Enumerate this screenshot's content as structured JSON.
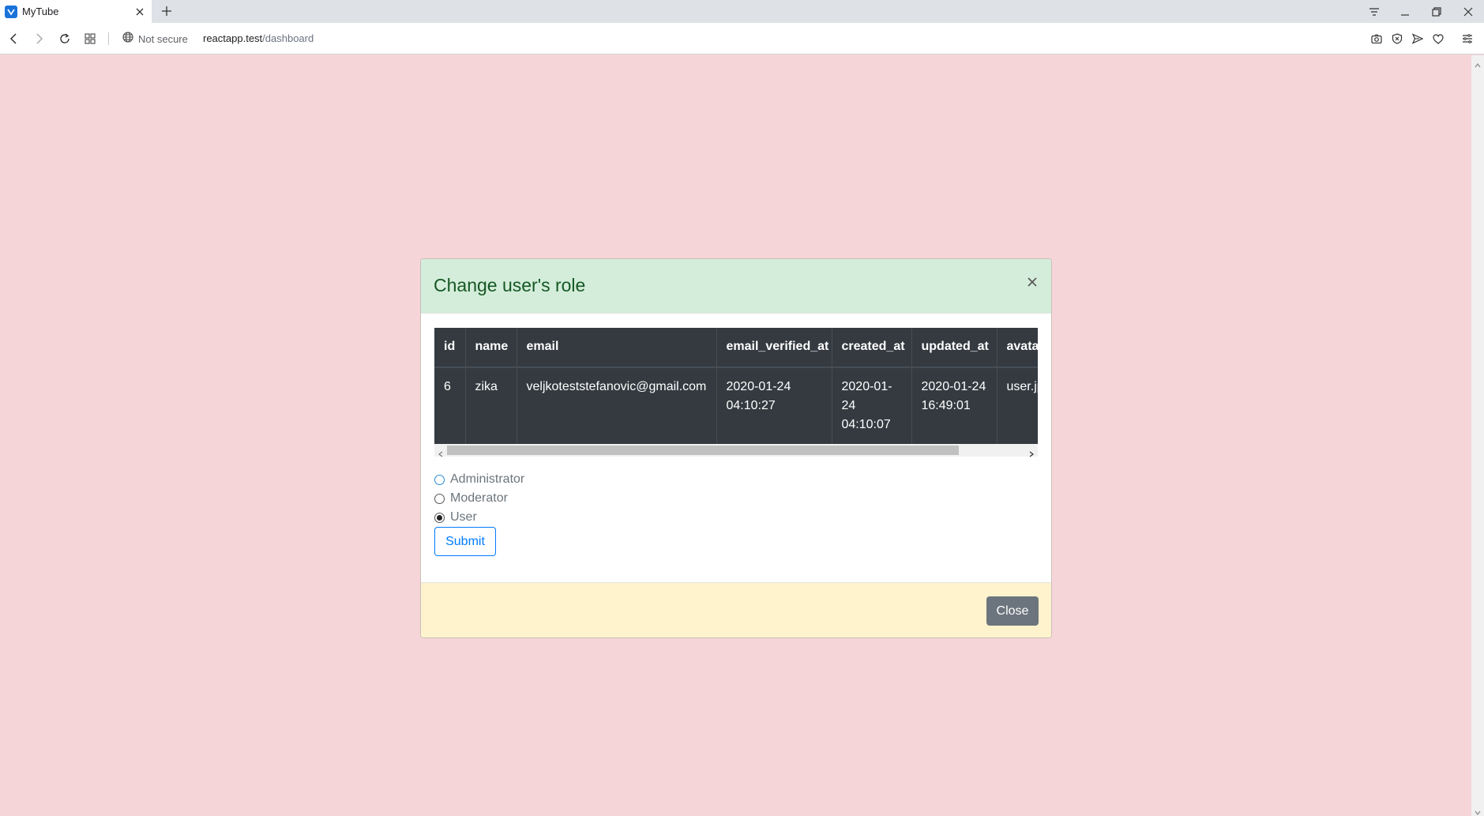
{
  "browser": {
    "tab_title": "MyTube",
    "security_label": "Not secure",
    "url_host": "reactapp.test",
    "url_path": "/dashboard"
  },
  "modal": {
    "title": "Change user's role",
    "table": {
      "columns": [
        "id",
        "name",
        "email",
        "email_verified_at",
        "created_at",
        "updated_at",
        "avatar"
      ],
      "rows": [
        {
          "id": "6",
          "name": "zika",
          "email": "veljkoteststefanovic@gmail.com",
          "email_verified_at": "2020-01-24 04:10:27",
          "created_at": "2020-01-24 04:10:07",
          "updated_at": "2020-01-24 16:49:01",
          "avatar": "user.jpg"
        }
      ]
    },
    "roles": [
      {
        "label": "Administrator",
        "checked": false
      },
      {
        "label": "Moderator",
        "checked": false
      },
      {
        "label": "User",
        "checked": true
      }
    ],
    "submit_label": "Submit",
    "close_label": "Close"
  },
  "colors": {
    "page_background": "#f5d5d8",
    "header_background": "#d4edda",
    "footer_background": "#fff3cd",
    "table_background": "#343a40",
    "primary": "#007bff",
    "secondary": "#6c757d"
  }
}
